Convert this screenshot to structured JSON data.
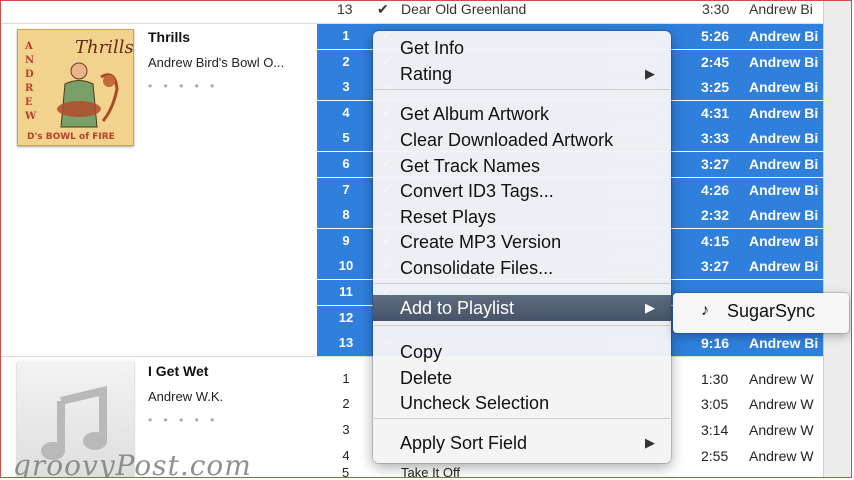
{
  "top_row": {
    "num": "13",
    "title": "Dear Old Greenland",
    "time": "3:30",
    "artist": "Andrew Bi"
  },
  "albums": [
    {
      "title": "Thrills",
      "artist": "Andrew Bird's Bowl O...",
      "rating": "• • • • •",
      "art_text": "Thrills",
      "art_side": "ANDREW BIRD'S BOWL OF FIRE"
    },
    {
      "title": "I Get Wet",
      "artist": "Andrew W.K.",
      "rating": "• • • • •"
    }
  ],
  "tracks": [
    {
      "num": "1",
      "time": "5:26",
      "artist": "Andrew Bi",
      "selected": true
    },
    {
      "num": "2",
      "time": "2:45",
      "artist": "Andrew Bi",
      "selected": true
    },
    {
      "num": "3",
      "time": "3:25",
      "artist": "Andrew Bi",
      "selected": true
    },
    {
      "num": "4",
      "time": "4:31",
      "artist": "Andrew Bi",
      "selected": true
    },
    {
      "num": "5",
      "time": "3:33",
      "artist": "Andrew Bi",
      "selected": true
    },
    {
      "num": "6",
      "time": "3:27",
      "artist": "Andrew Bi",
      "selected": true
    },
    {
      "num": "7",
      "time": "4:26",
      "artist": "Andrew Bi",
      "selected": true
    },
    {
      "num": "8",
      "time": "2:32",
      "artist": "Andrew Bi",
      "selected": true
    },
    {
      "num": "9",
      "time": "4:15",
      "artist": "Andrew Bi",
      "selected": true
    },
    {
      "num": "10",
      "time": "3:27",
      "artist": "Andrew Bi",
      "selected": true
    },
    {
      "num": "11",
      "time": "",
      "artist": "",
      "selected": true
    },
    {
      "num": "12",
      "time": "",
      "artist": "",
      "selected": true
    },
    {
      "num": "13",
      "time": "9:16",
      "artist": "Andrew Bi",
      "selected": true
    },
    {
      "num": "1",
      "time": "1:30",
      "artist": "Andrew W",
      "selected": false
    },
    {
      "num": "2",
      "time": "3:05",
      "artist": "Andrew W",
      "selected": false
    },
    {
      "num": "3",
      "time": "3:14",
      "artist": "Andrew W",
      "selected": false
    },
    {
      "num": "4",
      "time": "2:55",
      "artist": "Andrew W",
      "selected": false
    }
  ],
  "context_menu": {
    "items": [
      {
        "label": "Get Info",
        "submenu": false
      },
      {
        "label": "Rating",
        "submenu": true
      },
      {
        "label": "Get Album Artwork",
        "submenu": false
      },
      {
        "label": "Clear Downloaded Artwork",
        "submenu": false
      },
      {
        "label": "Get Track Names",
        "submenu": false
      },
      {
        "label": "Convert ID3 Tags...",
        "submenu": false
      },
      {
        "label": "Reset Plays",
        "submenu": false
      },
      {
        "label": "Create MP3 Version",
        "submenu": false
      },
      {
        "label": "Consolidate Files...",
        "submenu": false
      },
      {
        "label": "Add to Playlist",
        "submenu": true,
        "highlighted": true
      },
      {
        "label": "Copy",
        "submenu": false
      },
      {
        "label": "Delete",
        "submenu": false
      },
      {
        "label": "Uncheck Selection",
        "submenu": false
      },
      {
        "label": "Apply Sort Field",
        "submenu": true
      }
    ],
    "arrow_glyph": "▶"
  },
  "submenu": {
    "icon": "playlist-icon",
    "label": "SugarSync"
  },
  "watermark": "groovyPost.com",
  "colors": {
    "selection": "#2f7fdd",
    "menu_highlight": "#4f5c71",
    "frame_border": "#d24a4a"
  }
}
